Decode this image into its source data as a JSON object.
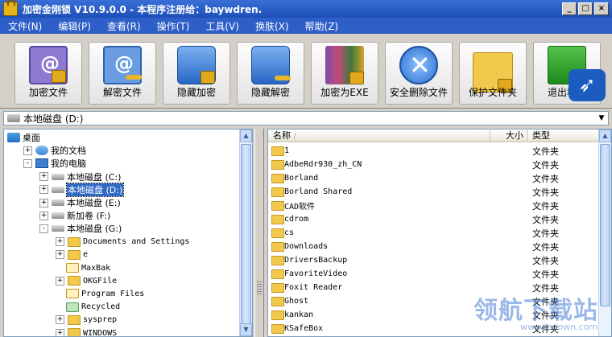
{
  "window": {
    "title": "加密金刚锁 V10.9.0.0 - 本程序注册给：baywdren.",
    "min": "_",
    "max": "□",
    "close": "×"
  },
  "menu": [
    "文件(N)",
    "编辑(P)",
    "查看(R)",
    "操作(T)",
    "工具(V)",
    "换肤(X)",
    "帮助(Z)"
  ],
  "toolbar": [
    {
      "label": "加密文件",
      "icon": "encrypt-book-icon"
    },
    {
      "label": "解密文件",
      "icon": "decrypt-book-icon"
    },
    {
      "label": "隐藏加密",
      "icon": "hidden-encrypt-disk-icon"
    },
    {
      "label": "隐藏解密",
      "icon": "hidden-decrypt-disk-icon"
    },
    {
      "label": "加密为EXE",
      "icon": "exe-archive-icon"
    },
    {
      "label": "安全删除文件",
      "icon": "secure-delete-icon"
    },
    {
      "label": "保护文件夹",
      "icon": "protect-folder-icon"
    },
    {
      "label": "退出程序",
      "icon": "exit-icon"
    }
  ],
  "address": {
    "value": "本地磁盘 (D:)"
  },
  "tree": [
    {
      "label": "桌面",
      "icon": "desktop",
      "indent": 0,
      "exp": ""
    },
    {
      "label": "我的文档",
      "icon": "docs",
      "indent": 1,
      "exp": "+"
    },
    {
      "label": "我的电脑",
      "icon": "pc",
      "indent": 1,
      "exp": "-"
    },
    {
      "label": "本地磁盘 (C:)",
      "icon": "drv",
      "indent": 2,
      "exp": "+"
    },
    {
      "label": "本地磁盘 (D:)",
      "icon": "drv",
      "indent": 2,
      "exp": "+",
      "selected": true
    },
    {
      "label": "本地磁盘 (E:)",
      "icon": "drv",
      "indent": 2,
      "exp": "+"
    },
    {
      "label": "新加卷 (F:)",
      "icon": "drv",
      "indent": 2,
      "exp": "+"
    },
    {
      "label": "本地磁盘 (G:)",
      "icon": "drv",
      "indent": 2,
      "exp": "-"
    },
    {
      "label": "Documents and Settings",
      "icon": "fold",
      "indent": 3,
      "exp": "+",
      "mono": true
    },
    {
      "label": "e",
      "icon": "fold",
      "indent": 3,
      "exp": "+",
      "mono": true
    },
    {
      "label": "MaxBak",
      "icon": "fold",
      "indent": 3,
      "exp": "",
      "mono": true
    },
    {
      "label": "OKGFile",
      "icon": "fold",
      "indent": 3,
      "exp": "+",
      "mono": true
    },
    {
      "label": "Program Files",
      "icon": "fold",
      "indent": 3,
      "exp": "",
      "mono": true
    },
    {
      "label": "Recycled",
      "icon": "recy",
      "indent": 3,
      "exp": "",
      "mono": true
    },
    {
      "label": "sysprep",
      "icon": "fold",
      "indent": 3,
      "exp": "+",
      "mono": true
    },
    {
      "label": "WINDOWS",
      "icon": "fold",
      "indent": 3,
      "exp": "+",
      "mono": true
    }
  ],
  "list": {
    "columns": {
      "name": "名称",
      "size": "大小",
      "type": "类型"
    },
    "rows": [
      {
        "name": "1",
        "type": "文件夹"
      },
      {
        "name": "AdbeRdr930_zh_CN",
        "type": "文件夹"
      },
      {
        "name": "Borland",
        "type": "文件夹"
      },
      {
        "name": "Borland Shared",
        "type": "文件夹"
      },
      {
        "name": "CAD软件",
        "type": "文件夹"
      },
      {
        "name": "cdrom",
        "type": "文件夹"
      },
      {
        "name": "cs",
        "type": "文件夹"
      },
      {
        "name": "Downloads",
        "type": "文件夹"
      },
      {
        "name": "DriversBackup",
        "type": "文件夹"
      },
      {
        "name": "FavoriteVideo",
        "type": "文件夹"
      },
      {
        "name": "Foxit Reader",
        "type": "文件夹"
      },
      {
        "name": "Ghost",
        "type": "文件夹"
      },
      {
        "name": "kankan",
        "type": "文件夹"
      },
      {
        "name": "KSafeBox",
        "type": "文件夹"
      }
    ]
  },
  "watermark": {
    "main": "领航下载站",
    "sub": "www.lhdown.com"
  }
}
